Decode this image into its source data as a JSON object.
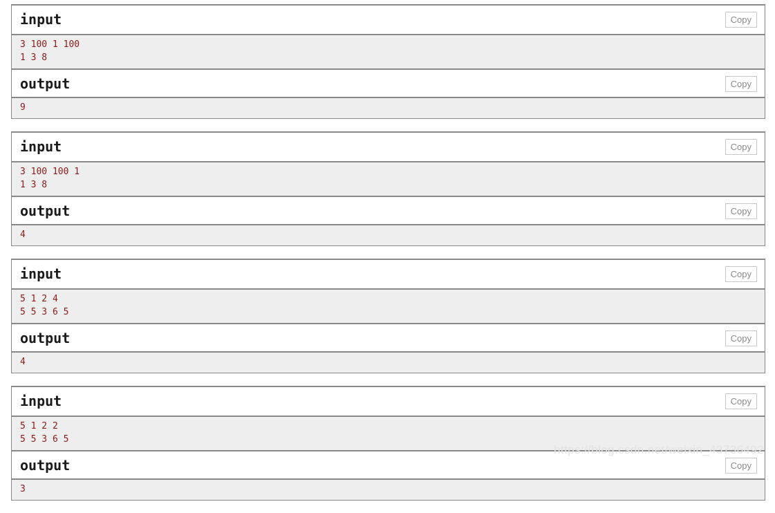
{
  "labels": {
    "input_title": "input",
    "output_title": "output",
    "copy_label": "Copy"
  },
  "colors": {
    "code_text": "#8b1a1a",
    "code_background": "#eeeeee",
    "panel_border": "#888888",
    "header_background": "#ffffff",
    "copy_button_text": "#8a8a8a",
    "copy_button_border": "#c9c9c9",
    "watermark_text": "#e2e2e2"
  },
  "sample_tests": [
    {
      "input_title": "input",
      "input_lines": [
        "3 100 1 100",
        "1 3 8"
      ],
      "input_copy_label": "Copy",
      "output_title": "output",
      "output_lines": [
        "9"
      ],
      "output_copy_label": "Copy"
    },
    {
      "input_title": "input",
      "input_lines": [
        "3 100 100 1",
        "1 3 8"
      ],
      "input_copy_label": "Copy",
      "output_title": "output",
      "output_lines": [
        "4"
      ],
      "output_copy_label": "Copy"
    },
    {
      "input_title": "input",
      "input_lines": [
        "5 1 2 4",
        "5 5 3 6 5"
      ],
      "input_copy_label": "Copy",
      "output_title": "output",
      "output_lines": [
        "4"
      ],
      "output_copy_label": "Copy"
    },
    {
      "input_title": "input",
      "input_lines": [
        "5 1 2 2",
        "5 5 3 6 5"
      ],
      "input_copy_label": "Copy",
      "output_title": "output",
      "output_lines": [
        "3"
      ],
      "output_copy_label": "Copy"
    }
  ],
  "watermark": {
    "text": "https://blog.csdn.net/weixin_43736492"
  }
}
